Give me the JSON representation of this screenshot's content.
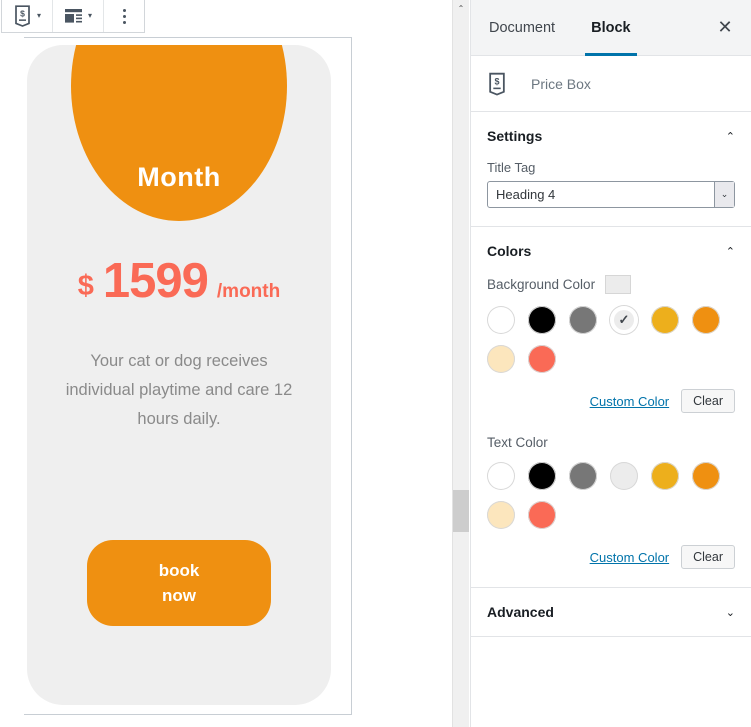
{
  "toolbar": {
    "block_icon": "price-tag-icon",
    "block_icon_glyph": "$",
    "align_icon": "media-position-icon",
    "more_icon": "vertical-dots-icon",
    "caret_glyph": "▾"
  },
  "editor": {
    "price_box": {
      "title": "Month",
      "currency": "$",
      "amount": "1599",
      "period": "/month",
      "description": "Your cat or dog receives individual playtime and care 12 hours daily.",
      "button_line1": "book",
      "button_line2": "now",
      "bg_color": "#efefef",
      "accent_color": "#ef9011",
      "price_color": "#fa6a56",
      "desc_color": "#8a8a8a"
    }
  },
  "scrollbar": {
    "up_glyph": "⌃"
  },
  "inspector": {
    "tabs": [
      {
        "label": "Document",
        "active": false
      },
      {
        "label": "Block",
        "active": true
      }
    ],
    "close_glyph": "✕",
    "block_card": {
      "icon": "price-tag-icon",
      "icon_glyph": "$",
      "label": "Price Box"
    },
    "settings_panel": {
      "title": "Settings",
      "chevron": "⌃",
      "expanded": true,
      "title_tag": {
        "label": "Title Tag",
        "value": "Heading 4",
        "caret": "⌄"
      }
    },
    "colors_panel": {
      "title": "Colors",
      "chevron": "⌃",
      "expanded": true,
      "background": {
        "label": "Background Color",
        "current": "#ececec",
        "swatches": [
          {
            "color": "#ffffff",
            "selected": false
          },
          {
            "color": "#000000",
            "selected": false
          },
          {
            "color": "#777777",
            "selected": false
          },
          {
            "color": "#ececec",
            "selected": true
          },
          {
            "color": "#edaf1c",
            "selected": false
          },
          {
            "color": "#ef9011",
            "selected": false
          },
          {
            "color": "#fce6bd",
            "selected": false
          },
          {
            "color": "#fa6a56",
            "selected": false
          }
        ],
        "custom_link": "Custom Color",
        "clear_label": "Clear",
        "check_glyph": "✓"
      },
      "text": {
        "label": "Text Color",
        "swatches": [
          {
            "color": "#ffffff",
            "selected": false
          },
          {
            "color": "#000000",
            "selected": false
          },
          {
            "color": "#777777",
            "selected": false
          },
          {
            "color": "#ececec",
            "selected": false
          },
          {
            "color": "#edaf1c",
            "selected": false
          },
          {
            "color": "#ef9011",
            "selected": false
          },
          {
            "color": "#fce6bd",
            "selected": false
          },
          {
            "color": "#fa6a56",
            "selected": false
          }
        ],
        "custom_link": "Custom Color",
        "clear_label": "Clear"
      }
    },
    "advanced_panel": {
      "title": "Advanced",
      "chevron": "⌄",
      "expanded": false
    }
  }
}
